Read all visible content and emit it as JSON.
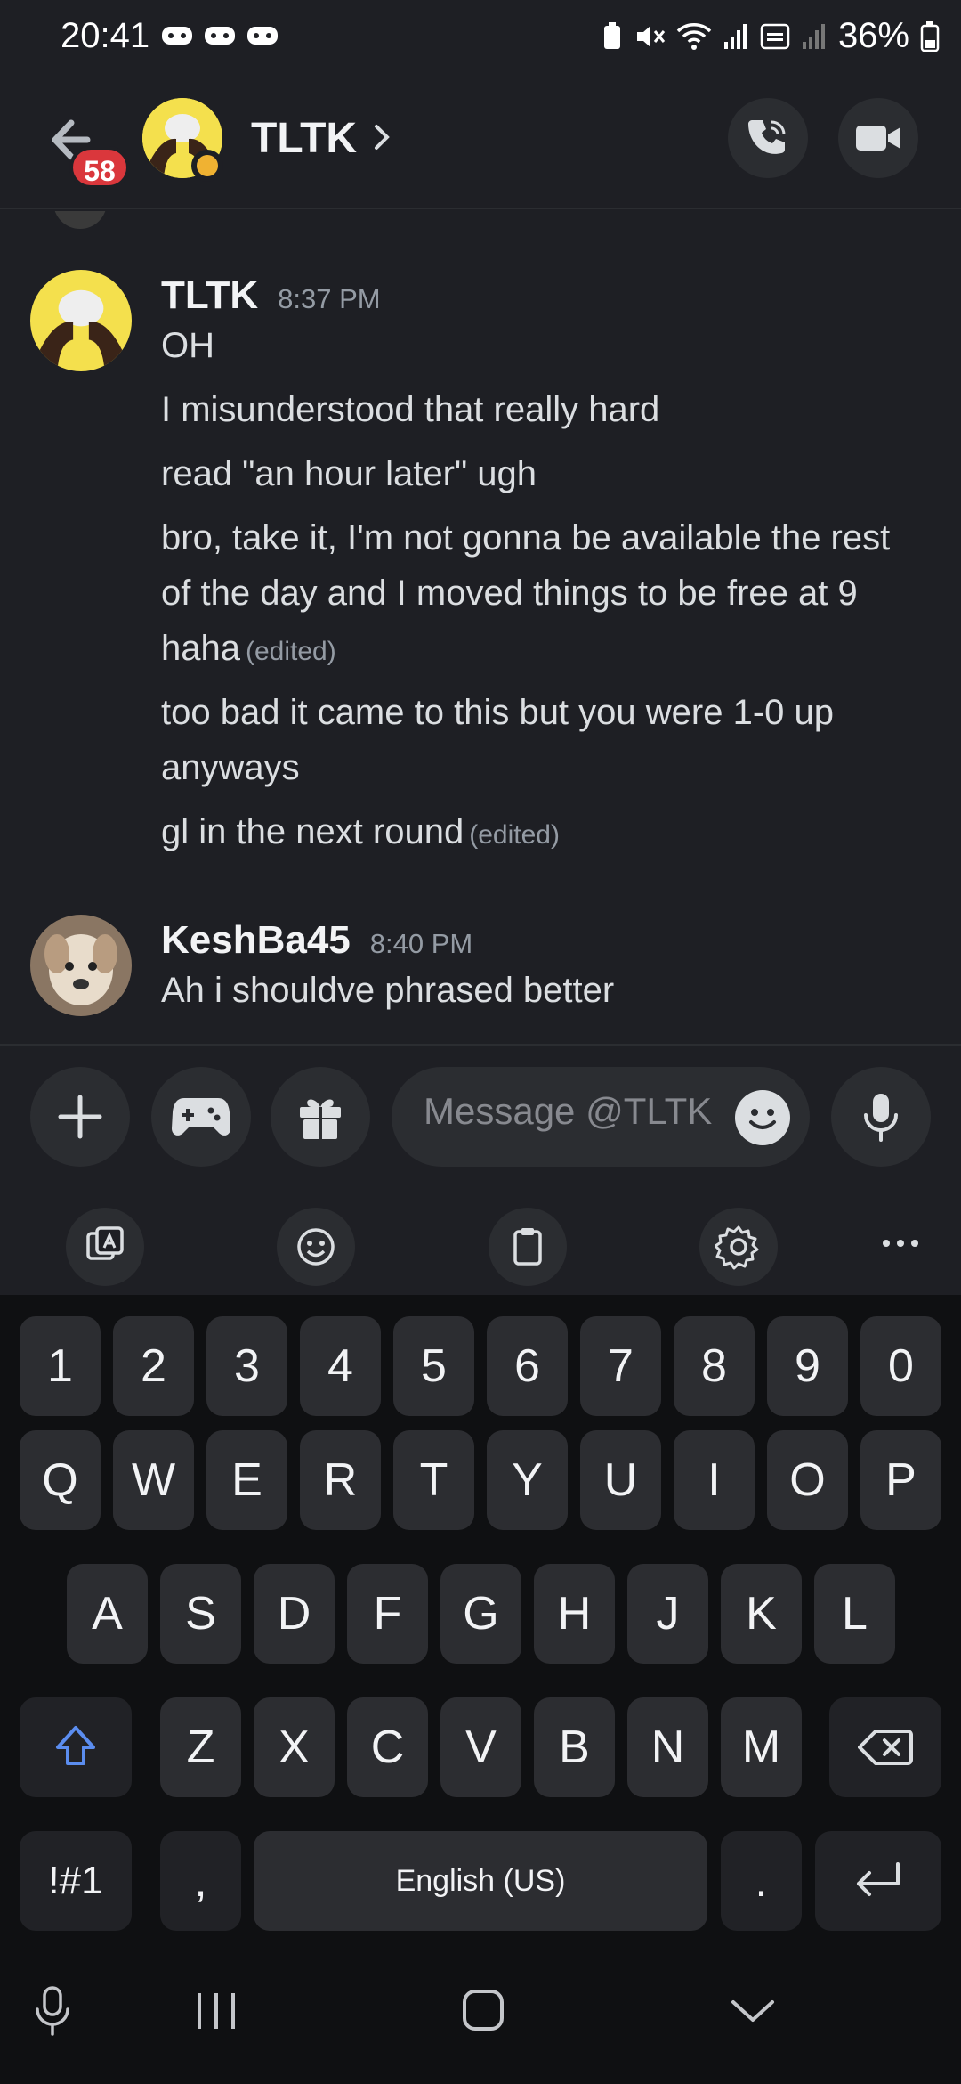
{
  "status_bar": {
    "time": "20:41",
    "battery": "36%"
  },
  "header": {
    "title": "TLTK",
    "unread_badge": "58"
  },
  "messages": [
    {
      "author": "TLTK",
      "time": "8:37 PM",
      "lines": [
        {
          "text": "OH",
          "edited": ""
        },
        {
          "text": "I misunderstood that really hard",
          "edited": ""
        },
        {
          "text": "read \"an hour later\" ugh",
          "edited": ""
        },
        {
          "text": "bro, take it, I'm not gonna be available the rest of the day and I moved things to be free at 9 haha",
          "edited": "(edited)"
        },
        {
          "text": "too bad it came to this but you were 1-0 up anyways",
          "edited": ""
        },
        {
          "text": "gl in the next round",
          "edited": "(edited)"
        }
      ]
    },
    {
      "author": "KeshBa45",
      "time": "8:40 PM",
      "lines": [
        {
          "text": "Ah i shouldve phrased better",
          "edited": ""
        }
      ]
    }
  ],
  "composer": {
    "placeholder": "Message @TLTK"
  },
  "keyboard": {
    "number_row": [
      "1",
      "2",
      "3",
      "4",
      "5",
      "6",
      "7",
      "8",
      "9",
      "0"
    ],
    "row1": [
      "Q",
      "W",
      "E",
      "R",
      "T",
      "Y",
      "U",
      "I",
      "O",
      "P"
    ],
    "row2": [
      "A",
      "S",
      "D",
      "F",
      "G",
      "H",
      "J",
      "K",
      "L"
    ],
    "row3": [
      "Z",
      "X",
      "C",
      "V",
      "B",
      "N",
      "M"
    ],
    "symbols_label": "!#1",
    "comma": ",",
    "space_label": "English (US)",
    "period": "."
  },
  "colors": {
    "background": "#1e1f24",
    "badge": "#da373c",
    "avatar_yellow": "#f4e04d",
    "status_idle": "#f0b232",
    "shift_accent": "#5b8def"
  }
}
